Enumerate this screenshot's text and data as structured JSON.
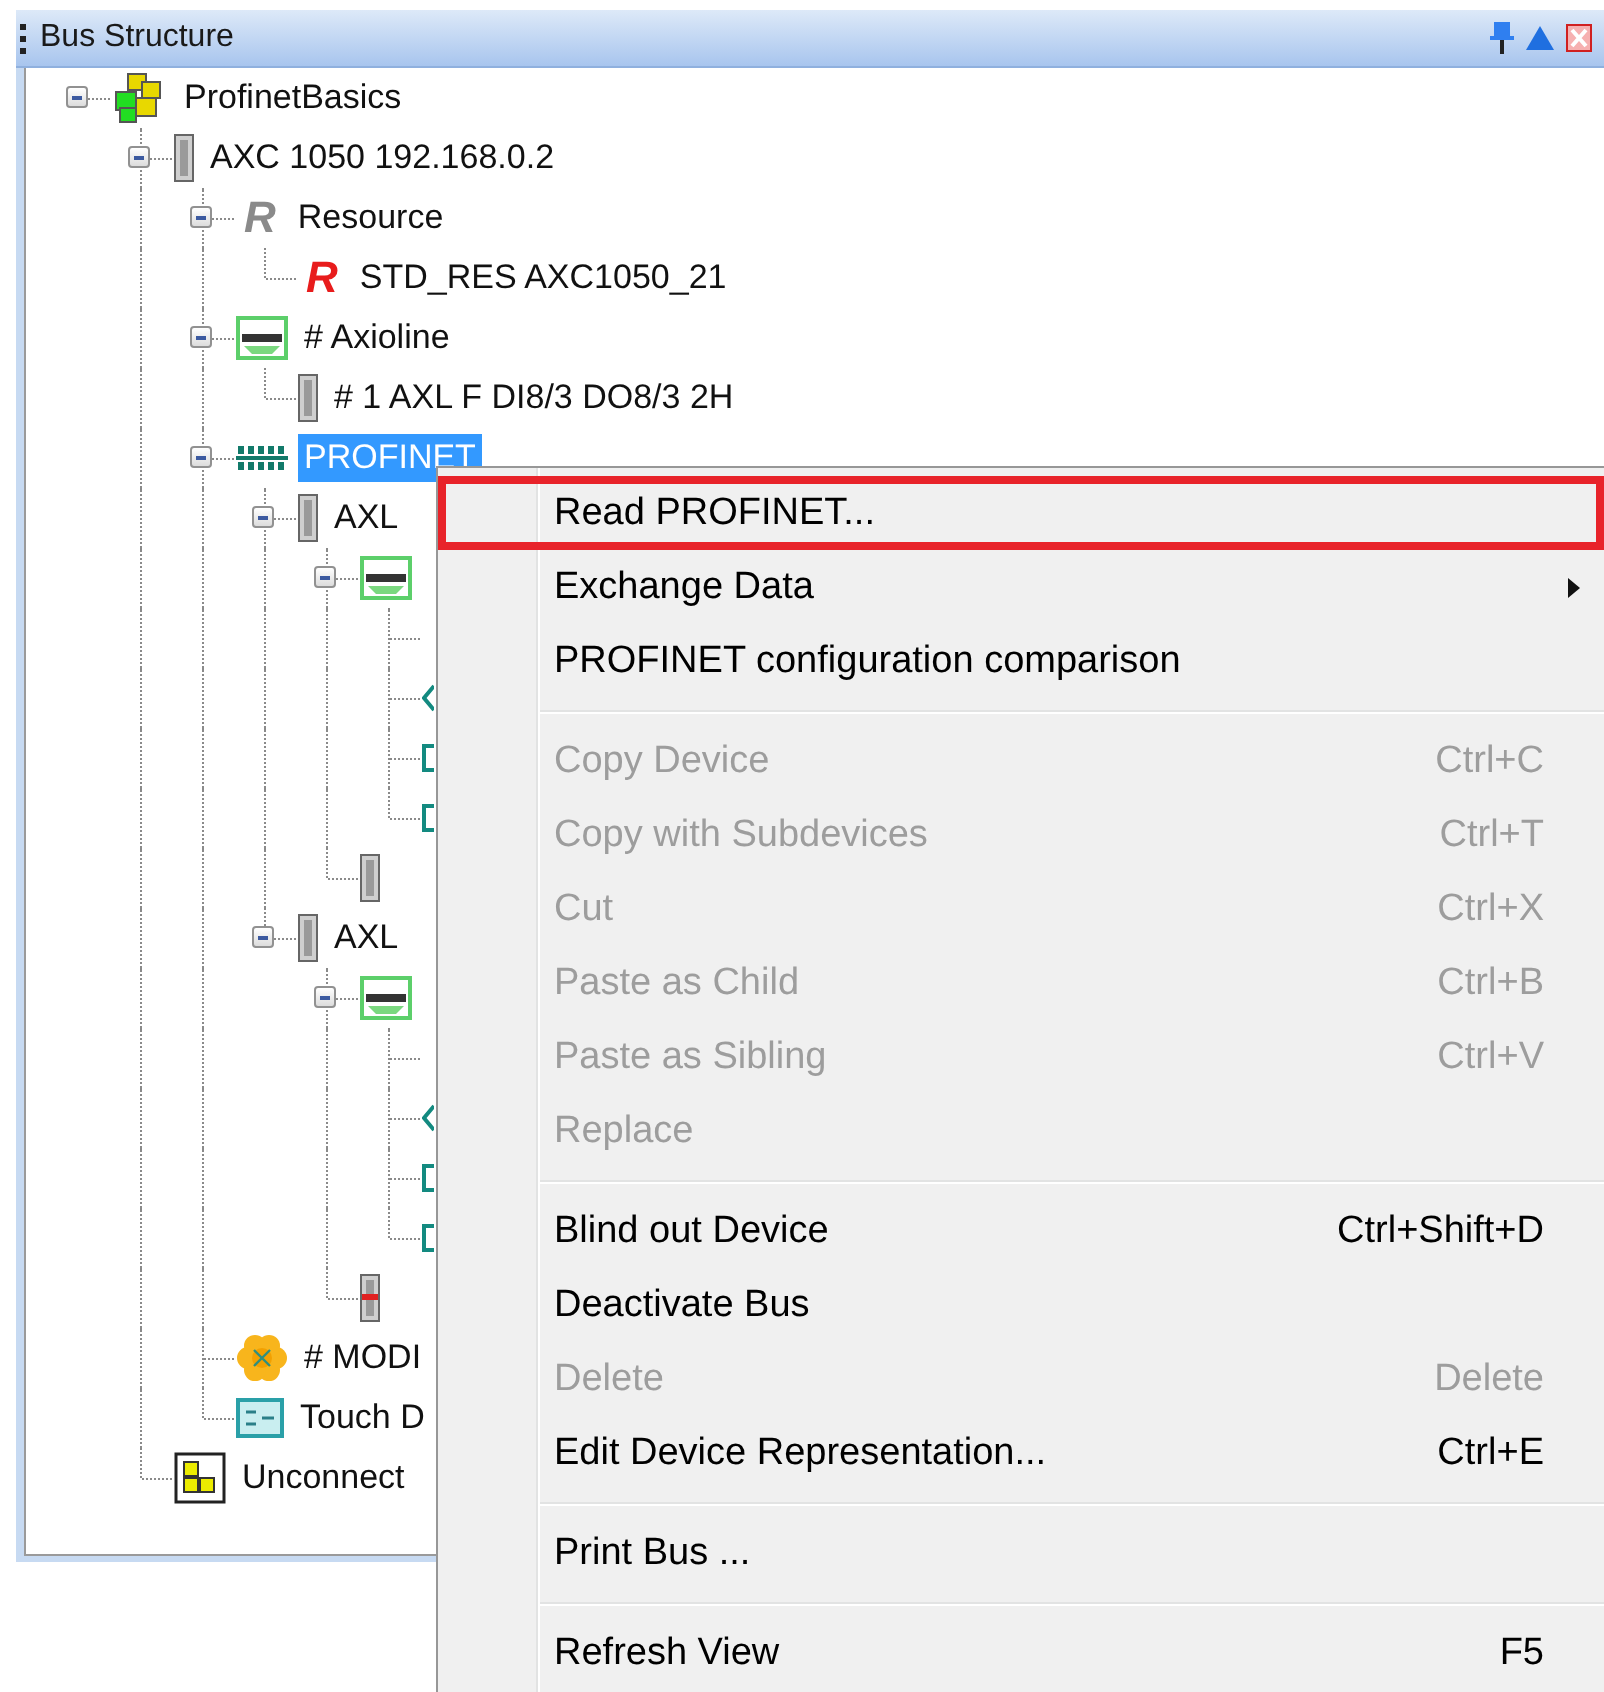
{
  "panel": {
    "title": "Bus Structure"
  },
  "tree": {
    "items": [
      {
        "kind": "project",
        "label": "ProfinetBasics",
        "selected": false,
        "expanded": true,
        "children": [
          {
            "kind": "controller",
            "label": "AXC 1050 192.168.0.2",
            "selected": false,
            "expanded": true,
            "children": [
              {
                "kind": "resource",
                "glyph": "R",
                "label": "Resource",
                "selected": false,
                "expanded": true,
                "children": [
                  {
                    "kind": "resource-instance",
                    "glyph": "R",
                    "label": "STD_RES AXC1050_21",
                    "selected": false
                  }
                ]
              },
              {
                "kind": "axio-bus",
                "label": "# Axioline",
                "selected": false,
                "expanded": true,
                "children": [
                  {
                    "kind": "device",
                    "label": "# 1 AXL F DI8/3 DO8/3 2H",
                    "selected": false
                  }
                ]
              },
              {
                "kind": "network",
                "label": "PROFINET",
                "selected": true,
                "expanded": true,
                "children": [
                  {
                    "kind": "device",
                    "label": "AXL",
                    "selected": false,
                    "expanded": true,
                    "children": [
                      {
                        "kind": "axio-bus",
                        "expanded": true,
                        "children": [
                          {
                            "kind": "none"
                          },
                          {
                            "kind": "variable"
                          },
                          {
                            "kind": "bracket"
                          },
                          {
                            "kind": "bracket"
                          }
                        ]
                      },
                      {
                        "kind": "device"
                      }
                    ]
                  },
                  {
                    "kind": "device",
                    "label": "AXL",
                    "selected": false,
                    "expanded": true,
                    "children": [
                      {
                        "kind": "axio-bus",
                        "expanded": true,
                        "children": [
                          {
                            "kind": "none"
                          },
                          {
                            "kind": "variable"
                          },
                          {
                            "kind": "bracket"
                          },
                          {
                            "kind": "bracket"
                          }
                        ]
                      },
                      {
                        "kind": "device-red"
                      }
                    ]
                  }
                ]
              },
              {
                "kind": "modbus",
                "label": "# MODI",
                "selected": false
              },
              {
                "kind": "touch-panel",
                "label": "Touch D",
                "selected": false
              }
            ]
          },
          {
            "kind": "unconnected",
            "label": "Unconnect",
            "selected": false
          }
        ]
      }
    ]
  },
  "context_menu": {
    "items": [
      {
        "kind": "item",
        "label": "Read PROFINET...",
        "disabled": false,
        "annotated": true
      },
      {
        "kind": "item",
        "label": "Exchange Data",
        "disabled": false,
        "submenu": true
      },
      {
        "kind": "item",
        "label": "PROFINET configuration comparison",
        "disabled": false
      },
      {
        "kind": "separator"
      },
      {
        "kind": "item",
        "label": "Copy Device",
        "shortcut": "Ctrl+C",
        "disabled": true
      },
      {
        "kind": "item",
        "label": "Copy with Subdevices",
        "shortcut": "Ctrl+T",
        "disabled": true
      },
      {
        "kind": "item",
        "label": "Cut",
        "shortcut": "Ctrl+X",
        "disabled": true
      },
      {
        "kind": "item",
        "label": "Paste as Child",
        "shortcut": "Ctrl+B",
        "disabled": true
      },
      {
        "kind": "item",
        "label": "Paste as Sibling",
        "shortcut": "Ctrl+V",
        "disabled": true
      },
      {
        "kind": "item",
        "label": "Replace",
        "disabled": true
      },
      {
        "kind": "separator"
      },
      {
        "kind": "item",
        "label": "Blind out Device",
        "shortcut": "Ctrl+Shift+D",
        "disabled": false
      },
      {
        "kind": "item",
        "label": "Deactivate Bus",
        "disabled": false
      },
      {
        "kind": "item",
        "label": "Delete",
        "shortcut": "Delete",
        "disabled": true
      },
      {
        "kind": "item",
        "label": "Edit Device Representation...",
        "shortcut": "Ctrl+E",
        "disabled": false
      },
      {
        "kind": "separator"
      },
      {
        "kind": "item",
        "label": "Print Bus ...",
        "disabled": false
      },
      {
        "kind": "separator"
      },
      {
        "kind": "item",
        "label": "Refresh View",
        "shortcut": "F5",
        "disabled": false
      }
    ]
  }
}
